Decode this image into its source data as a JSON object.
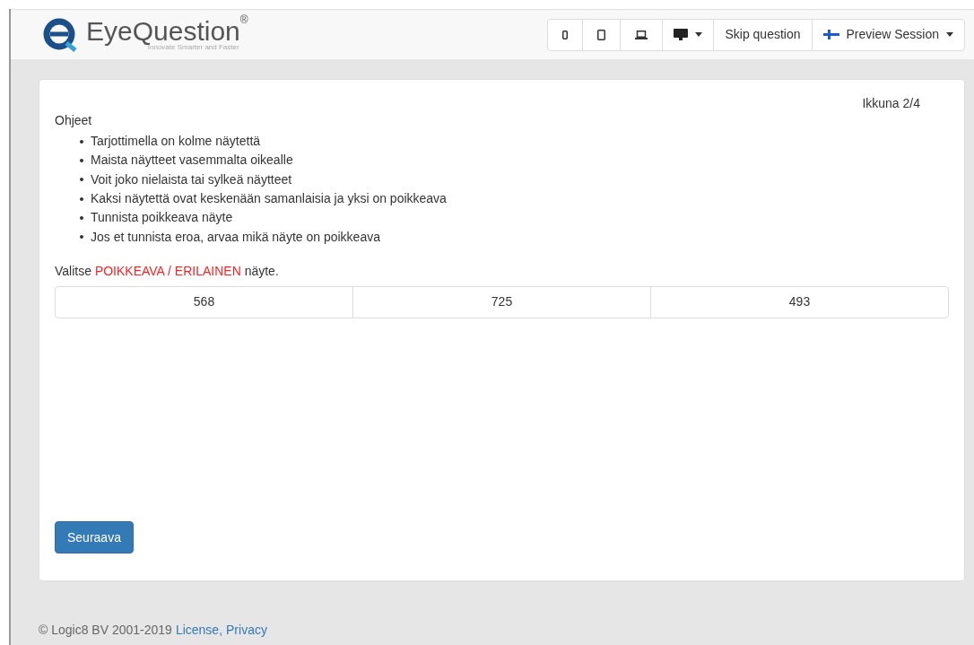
{
  "header": {
    "logo": {
      "name": "EyeQuestion",
      "mark": "®",
      "tagline": "Innovate Smarter and Faster"
    },
    "toolbar": [
      {
        "kind": "phone"
      },
      {
        "kind": "tablet"
      },
      {
        "kind": "laptop"
      },
      {
        "kind": "desktop",
        "dropdown": true
      },
      {
        "kind": "text",
        "label": "Skip question"
      },
      {
        "kind": "flag",
        "label": "Preview Session",
        "dropdown": true
      }
    ]
  },
  "card": {
    "page_indicator": "Ikkuna 2/4",
    "instructions_title": "Ohjeet",
    "instructions": [
      "Tarjottimella on kolme näytettä",
      "Maista näytteet vasemmalta oikealle",
      "Voit joko nielaista tai sylkeä näytteet",
      "Kaksi näytettä ovat keskenään samanlaisia ja yksi on poikkeava",
      "Tunnista poikkeava näyte",
      "Jos et tunnista eroa, arvaa mikä näyte on poikkeava"
    ],
    "question": {
      "before": "Valitse ",
      "highlight": "POIKKEAVA / ERILAINEN",
      "after": " näyte."
    },
    "options": [
      "568",
      "725",
      "493"
    ],
    "next_button": "Seuraava"
  },
  "footer": {
    "copyright": "© Logic8 BV 2001-2019",
    "links": [
      {
        "label": "License,"
      },
      {
        "label": "Privacy"
      }
    ]
  }
}
